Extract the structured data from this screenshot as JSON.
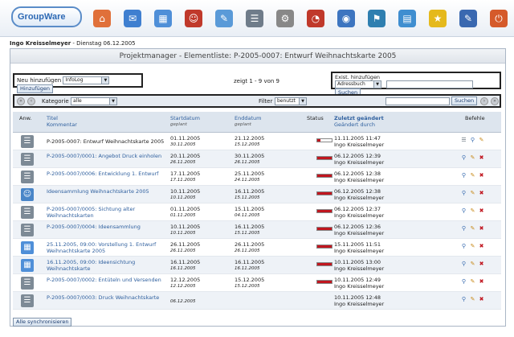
{
  "app": {
    "logo_text": "GroupWare"
  },
  "apps": [
    {
      "name": "home-icon",
      "glyph": "⌂",
      "color": "#e0703a"
    },
    {
      "name": "email-icon",
      "glyph": "✉",
      "color": "#3f7fd0"
    },
    {
      "name": "calendar-icon",
      "glyph": "▦",
      "color": "#4f8fd8"
    },
    {
      "name": "addressbook-icon",
      "glyph": "☺",
      "color": "#c0392b"
    },
    {
      "name": "notes-icon",
      "glyph": "✎",
      "color": "#5a9ad8"
    },
    {
      "name": "infolog-icon",
      "glyph": "☰",
      "color": "#6f7c8a"
    },
    {
      "name": "projectmanager-icon",
      "glyph": "⚙",
      "color": "#888"
    },
    {
      "name": "timesheet-icon",
      "glyph": "◔",
      "color": "#c0392b"
    },
    {
      "name": "wiki-icon",
      "glyph": "◉",
      "color": "#3d75c0"
    },
    {
      "name": "sitemgr-icon",
      "glyph": "⚑",
      "color": "#2f7fb0"
    },
    {
      "name": "filemanager-icon",
      "glyph": "▤",
      "color": "#3f8ed0"
    },
    {
      "name": "bookmarks-icon",
      "glyph": "★",
      "color": "#e5b91c"
    },
    {
      "name": "preferences-icon",
      "glyph": "✎",
      "color": "#3a68b0"
    },
    {
      "name": "logout-icon",
      "glyph": "⏻",
      "color": "#d55a2a"
    }
  ],
  "user": {
    "name": "Ingo Kreisselmeyer",
    "rest": " - Dienstag 06.12.2005"
  },
  "page_title": "Projektmanager - Elementliste: P-2005-0007: Entwurf Weihnachtskarte 2005",
  "add_new": {
    "label": "Neu hinzufügen",
    "selected": "InfoLog",
    "button": "Hinzufügen"
  },
  "paging": "zeigt 1 - 9 von 9",
  "add_existing": {
    "label": "Exist. hinzufügen",
    "selected": "Adressbuch",
    "button": "Suchen"
  },
  "filterbar": {
    "category_label": "Kategorie",
    "category_value": "alle",
    "filter_label": "Filter",
    "filter_value": "benutzt",
    "search_button": "Suchen"
  },
  "columns": {
    "type": "Anw.",
    "title": "Titel",
    "title_sub": "Kommentar",
    "start": "Startdatum",
    "start_sub": "geplant",
    "end": "Enddatum",
    "end_sub": "geplant",
    "status": "Status",
    "changed": "Zuletzt geändert",
    "changed_sub": "Geändert durch",
    "actions": "Befehle"
  },
  "rows": [
    {
      "type": "infolog",
      "title": "P-2005-0007: Entwurf Weihnachtskarte 2005",
      "start": "01.11.2005",
      "start_planned": "30.11.2005",
      "end": "21.12.2005",
      "end_planned": "15.12.2005",
      "status": 0.2,
      "changed": "11.11.2005 11:47",
      "by": "Ingo Kreisselmeyer"
    },
    {
      "type": "infolog",
      "title": "P-2005-0007/0001: Angebot Druck einholen",
      "start": "20.11.2005",
      "start_planned": "26.11.2005",
      "end": "30.11.2005",
      "end_planned": "26.11.2005",
      "status": 1,
      "changed": "06.12.2005 12:39",
      "by": "Ingo Kreisselmeyer"
    },
    {
      "type": "infolog",
      "title": "P-2005-0007/0006: Entwicklung 1. Entwurf",
      "start": "17.11.2005",
      "start_planned": "17.11.2005",
      "end": "25.11.2005",
      "end_planned": "24.11.2005",
      "status": 1,
      "changed": "06.12.2005 12:38",
      "by": "Ingo Kreisselmeyer"
    },
    {
      "type": "addressbook",
      "title": "Ideensammlung Weihnachtskarte 2005",
      "start": "10.11.2005",
      "start_planned": "10.11.2005",
      "end": "16.11.2005",
      "end_planned": "15.11.2005",
      "status": 1,
      "changed": "06.12.2005 12:38",
      "by": "Ingo Kreisselmeyer"
    },
    {
      "type": "infolog",
      "title": "P-2005-0007/0005: Sichtung alter Weihnachtskarten",
      "start": "01.11.2005",
      "start_planned": "01.11.2005",
      "end": "15.11.2005",
      "end_planned": "04.11.2005",
      "status": 1,
      "changed": "06.12.2005 12:37",
      "by": "Ingo Kreisselmeyer"
    },
    {
      "type": "infolog",
      "title": "P-2005-0007/0004: Ideensammlung",
      "start": "10.11.2005",
      "start_planned": "10.11.2005",
      "end": "16.11.2005",
      "end_planned": "15.11.2005",
      "status": 1,
      "changed": "06.12.2005 12:36",
      "by": "Ingo Kreisselmeyer"
    },
    {
      "type": "calendar",
      "title": "25.11.2005, 09:00: Vorstellung 1. Entwurf Weihnachtskarte 2005",
      "start": "26.11.2005",
      "start_planned": "26.11.2005",
      "end": "26.11.2005",
      "end_planned": "26.11.2005",
      "status": 1,
      "changed": "15.11.2005 11:51",
      "by": "Ingo Kreisselmeyer"
    },
    {
      "type": "calendar",
      "title": "16.11.2005, 09:00: Ideensichtung Weihnachtskarte",
      "start": "16.11.2005",
      "start_planned": "16.11.2005",
      "end": "16.11.2005",
      "end_planned": "16.11.2005",
      "status": 1,
      "changed": "10.11.2005 13:00",
      "by": "Ingo Kreisselmeyer"
    },
    {
      "type": "infolog",
      "title": "P-2005-0007/0002: Entüteln und Versenden",
      "start": "12.12.2005",
      "start_planned": "12.12.2005",
      "end": "15.12.2005",
      "end_planned": "15.12.2005",
      "status": 1,
      "changed": "10.11.2005 12:49",
      "by": "Ingo Kreisselmeyer"
    },
    {
      "type": "infolog",
      "title": "P-2005-0007/0003: Druck Weihnachtskarte",
      "start": "",
      "start_planned": "06.12.2005",
      "end": "",
      "end_planned": "",
      "status": null,
      "changed": "10.11.2005 12:48",
      "by": "Ingo Kreisselmeyer"
    }
  ],
  "sync_button": "Alle synchronisieren"
}
